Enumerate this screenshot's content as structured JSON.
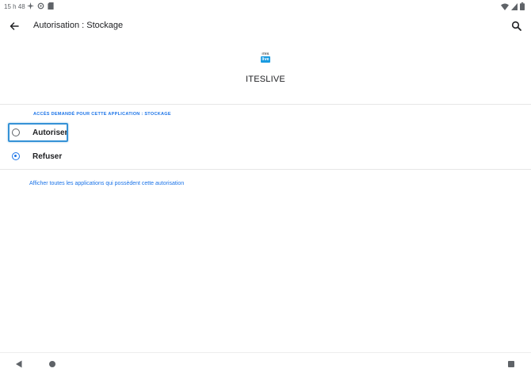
{
  "status_bar": {
    "time": "15 h 48",
    "icons": [
      "sparkle-icon",
      "sync-icon",
      "sd-card-icon"
    ],
    "right_icons": [
      "wifi-icon",
      "signal-icon",
      "battery-icon"
    ]
  },
  "app_bar": {
    "title": "Autorisation : Stockage"
  },
  "app_header": {
    "icon_top": "ITES",
    "icon_box": "live",
    "name": "ITESLIVE"
  },
  "permission": {
    "section_label": "ACCÈS DEMANDÉ POUR CETTE APPLICATION : STOCKAGE",
    "options": [
      {
        "label": "Autoriser",
        "selected": false
      },
      {
        "label": "Refuser",
        "selected": true
      }
    ],
    "see_all_link": "Afficher toutes les applications qui possèdent cette autorisation"
  },
  "colors": {
    "accent": "#1a73e8",
    "highlight": "#3592d6"
  }
}
